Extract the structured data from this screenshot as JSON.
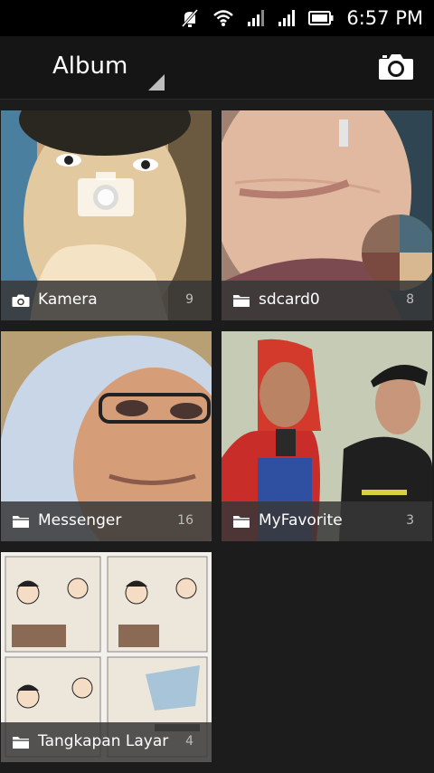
{
  "status_bar": {
    "time": "6:57 PM",
    "icons": [
      "mute-icon",
      "wifi-icon",
      "signal-icon",
      "signal-icon",
      "battery-icon"
    ]
  },
  "action_bar": {
    "title": "Album",
    "camera_icon": "camera-icon"
  },
  "albums": [
    {
      "name": "Kamera",
      "count": "9",
      "icon": "camera-icon"
    },
    {
      "name": "sdcard0",
      "count": "8",
      "icon": "folder-icon"
    },
    {
      "name": "Messenger",
      "count": "16",
      "icon": "folder-icon"
    },
    {
      "name": "MyFavorite",
      "count": "3",
      "icon": "folder-icon"
    },
    {
      "name": "Tangkapan Layar",
      "count": "4",
      "icon": "folder-icon"
    }
  ]
}
